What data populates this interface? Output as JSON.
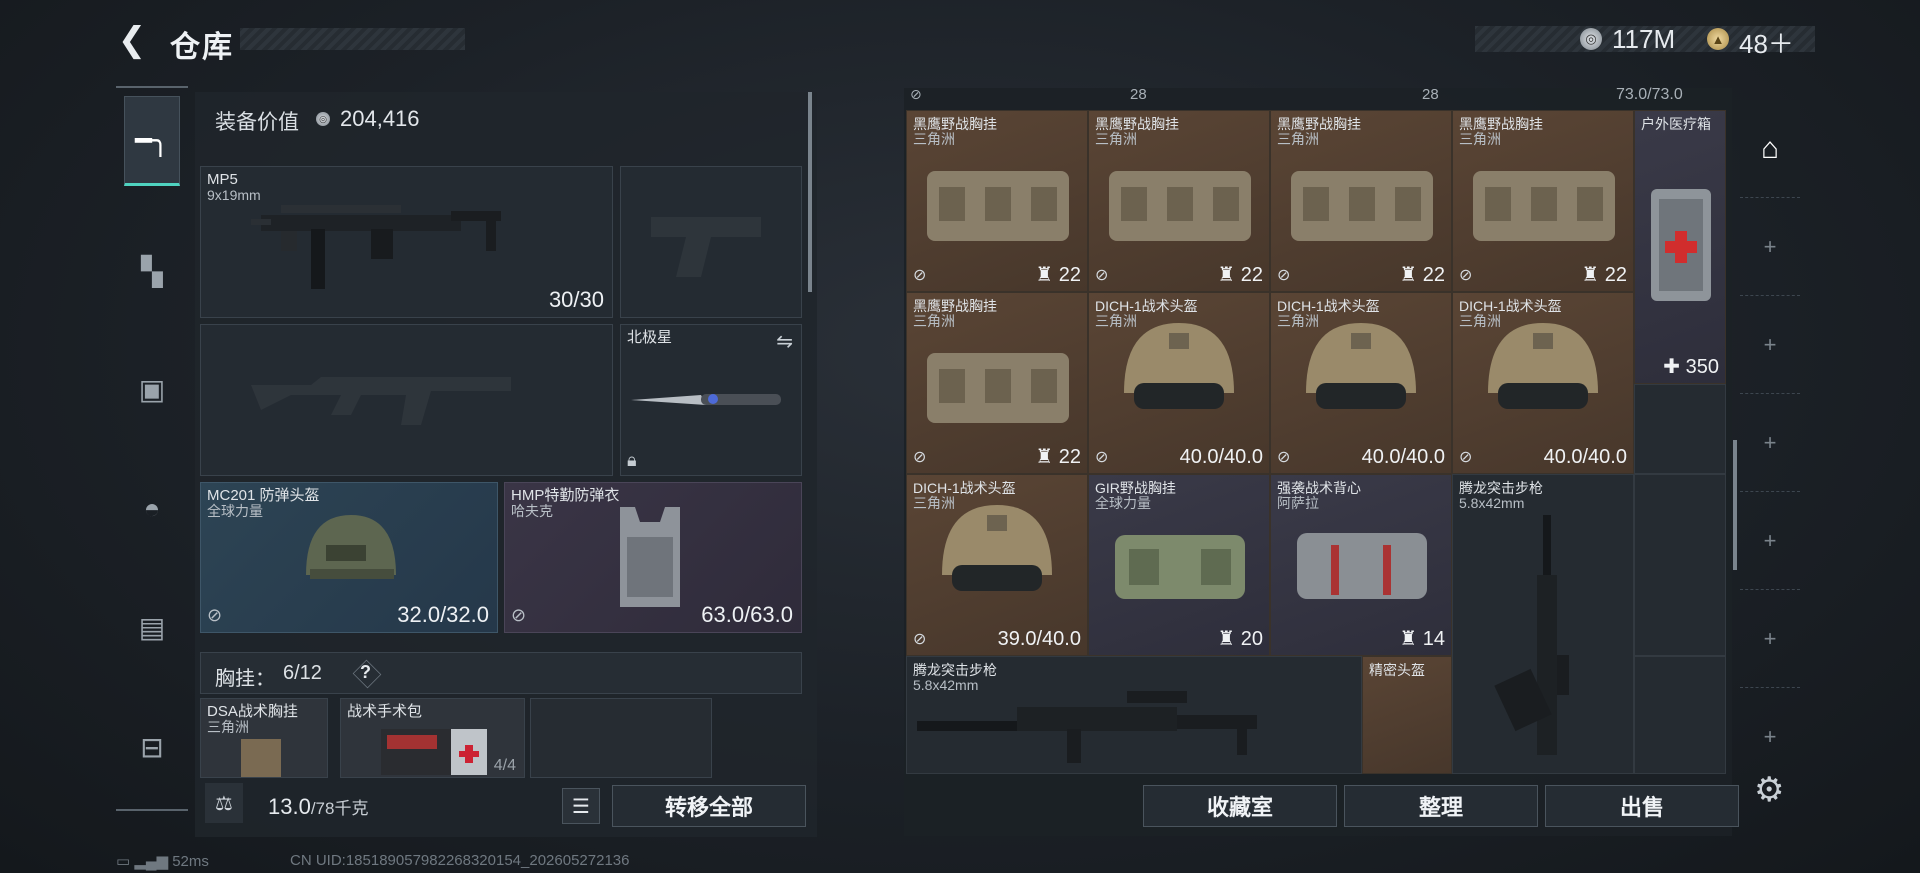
{
  "header": {
    "back_icon": "arrow-left-icon",
    "title": "仓库"
  },
  "currency": {
    "silver_value": "117M",
    "gold_value": "48＋"
  },
  "sidebar": {
    "items": [
      {
        "icon": "pistol-icon",
        "active": true
      },
      {
        "icon": "vest-icon",
        "active": false
      },
      {
        "icon": "backpack-icon",
        "active": false
      },
      {
        "icon": "helmet-icon",
        "active": false
      },
      {
        "icon": "clipboard-icon",
        "active": false
      },
      {
        "icon": "toolbox-icon",
        "active": false
      }
    ]
  },
  "equipment": {
    "value_label": "装备价值",
    "value": "204,416",
    "primary_weapon": {
      "name": "MP5",
      "caliber": "9x19mm",
      "ammo": "30/30"
    },
    "melee": {
      "name": "北极星"
    },
    "helmet": {
      "name": "MC201 防弹头盔",
      "maker": "全球力量",
      "durability": "32.0/32.0"
    },
    "armor": {
      "name": "HMP特勤防弹衣",
      "maker": "哈夫克",
      "durability": "63.0/63.0"
    },
    "rig": {
      "label": "胸挂：",
      "count": "6/12",
      "help": "?"
    },
    "rig_items": [
      {
        "name": "DSA战术胸挂",
        "maker": "三角洲"
      },
      {
        "name": "战术手术包",
        "count": "4/4"
      }
    ]
  },
  "weight": {
    "value": "13.0",
    "max": "/78千克"
  },
  "buttons": {
    "transfer_all": "转移全部",
    "collection": "收藏室",
    "organize": "整理",
    "sell": "出售"
  },
  "inventory_top_row": {
    "a": "28",
    "b": "28",
    "c": "73.0/73.0"
  },
  "inventory": [
    {
      "name": "黑鹰野战胸挂",
      "maker": "三角洲",
      "count": "22"
    },
    {
      "name": "黑鹰野战胸挂",
      "maker": "三角洲",
      "count": "22"
    },
    {
      "name": "黑鹰野战胸挂",
      "maker": "三角洲",
      "count": "22"
    },
    {
      "name": "黑鹰野战胸挂",
      "maker": "三角洲",
      "count": "22"
    },
    {
      "name": "户外医疗箱",
      "count": "350"
    },
    {
      "name": "黑鹰野战胸挂",
      "maker": "三角洲",
      "count": "22"
    },
    {
      "name": "DICH-1战术头盔",
      "maker": "三角洲",
      "durability": "40.0/40.0"
    },
    {
      "name": "DICH-1战术头盔",
      "maker": "三角洲",
      "durability": "40.0/40.0"
    },
    {
      "name": "DICH-1战术头盔",
      "maker": "三角洲",
      "durability": "40.0/40.0"
    },
    {
      "name": "DICH-1战术头盔",
      "maker": "三角洲",
      "durability": "39.0/40.0"
    },
    {
      "name": "GIR野战胸挂",
      "maker": "全球力量",
      "count": "20"
    },
    {
      "name": "强袭战术背心",
      "maker": "阿萨拉",
      "count": "14"
    },
    {
      "name": "腾龙突击步枪",
      "caliber": "5.8x42mm"
    },
    {
      "name": "腾龙突击步枪",
      "caliber": "5.8x42mm"
    },
    {
      "name": "精密头盔"
    }
  ],
  "status": {
    "ping": "52ms",
    "uid": "CN UID:185189057982268320154_202605272136"
  }
}
